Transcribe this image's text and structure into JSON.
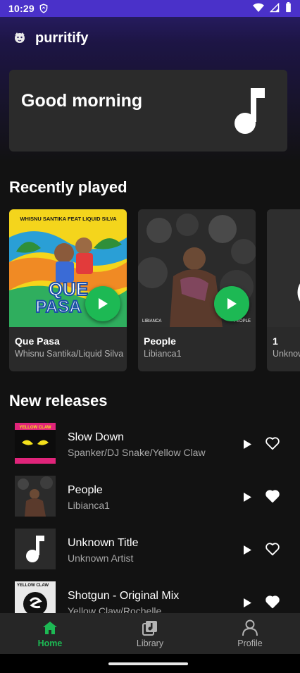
{
  "status_bar": {
    "time": "10:29"
  },
  "app": {
    "title": "purritify"
  },
  "greeting": {
    "text": "Good morning"
  },
  "recently_played": {
    "title": "Recently played",
    "items": [
      {
        "name": "Que Pasa",
        "artist": "Whisnu Santika/Liquid Silva",
        "art_text_top": "WHISNU SANTIKA  FEAT  LIQUID SILVA",
        "art_text_main": "QUE PASA"
      },
      {
        "name": "People",
        "artist": "Libianca1",
        "art_text_left": "LIBIANCA",
        "art_text_right": "PEOPLE"
      },
      {
        "name": "1",
        "artist": "Unknown Artist"
      }
    ]
  },
  "new_releases": {
    "title": "New releases",
    "items": [
      {
        "title": "Slow Down",
        "artist": "Spanker/DJ Snake/Yellow Claw",
        "liked": false,
        "thumb_label": "YELLOW CLAW"
      },
      {
        "title": "People",
        "artist": "Libianca1",
        "liked": true
      },
      {
        "title": "Unknown Title",
        "artist": "Unknown Artist",
        "liked": false
      },
      {
        "title": "Shotgun - Original Mix",
        "artist": "Yellow Claw/Rochelle",
        "liked": true,
        "thumb_label": "YELLOW CLAW"
      }
    ]
  },
  "bottom_nav": {
    "items": [
      {
        "label": "Home",
        "icon": "home-icon",
        "active": true
      },
      {
        "label": "Library",
        "icon": "library-icon",
        "active": false
      },
      {
        "label": "Profile",
        "icon": "profile-icon",
        "active": false
      }
    ]
  },
  "colors": {
    "accent": "#1db954",
    "background": "#121212",
    "card": "#2b2b2b",
    "status_bar": "#4a31c9"
  }
}
